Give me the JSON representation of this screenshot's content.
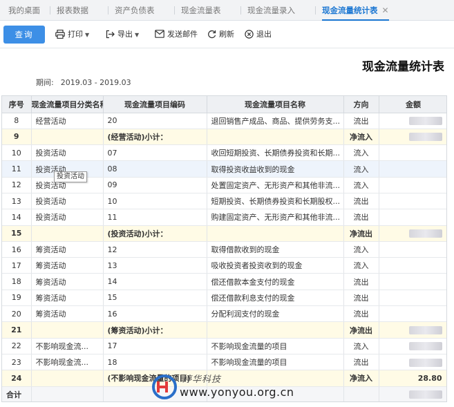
{
  "tabs": [
    {
      "label": "我的桌面"
    },
    {
      "label": "报表数据"
    },
    {
      "label": "资产负债表"
    },
    {
      "label": "现金流量表"
    },
    {
      "label": "现金流量录入"
    },
    {
      "label": "现金流量统计表",
      "active": true
    }
  ],
  "toolbar": {
    "query": "查询",
    "print": "打印",
    "export": "导出",
    "email": "发送邮件",
    "refresh": "刷新",
    "exit": "退出"
  },
  "report": {
    "title": "现金流量统计表",
    "period_label": "期间:",
    "period_value": "2019.03 - 2019.03"
  },
  "table": {
    "headers": [
      "序号",
      "现金流量项目分类名称",
      "现金流量项目编码",
      "现金流量项目名称",
      "方向",
      "金额"
    ],
    "rows": [
      {
        "no": "8",
        "cat": "经营活动",
        "code": "20",
        "name": "退回销售产成品、商品、提供劳务支...",
        "dir": "流出",
        "amt": ""
      },
      {
        "no": "9",
        "cat": "",
        "code": "(经营活动)小计：",
        "name": "",
        "dir": "净流入",
        "amt": ""
      },
      {
        "no": "10",
        "cat": "投资活动",
        "code": "07",
        "name": "收回短期投资、长期债券投资和长期...",
        "dir": "流入",
        "amt": ""
      },
      {
        "no": "11",
        "cat": "投资活动",
        "code": "08",
        "name": "取得投资收益收到的现金",
        "dir": "流入",
        "amt": ""
      },
      {
        "no": "12",
        "cat": "投资活动",
        "code": "09",
        "name": "处置固定资产、无形资产和其他非流...",
        "dir": "流入",
        "amt": ""
      },
      {
        "no": "13",
        "cat": "投资活动",
        "code": "10",
        "name": "短期投资、长期债券投资和长期股权...",
        "dir": "流出",
        "amt": ""
      },
      {
        "no": "14",
        "cat": "投资活动",
        "code": "11",
        "name": "购建固定资产、无形资产和其他非流...",
        "dir": "流出",
        "amt": ""
      },
      {
        "no": "15",
        "cat": "",
        "code": "(投资活动)小计：",
        "name": "",
        "dir": "净流出",
        "amt": ""
      },
      {
        "no": "16",
        "cat": "筹资活动",
        "code": "12",
        "name": "取得借款收到的现金",
        "dir": "流入",
        "amt": ""
      },
      {
        "no": "17",
        "cat": "筹资活动",
        "code": "13",
        "name": "吸收投资者投资收到的现金",
        "dir": "流入",
        "amt": ""
      },
      {
        "no": "18",
        "cat": "筹资活动",
        "code": "14",
        "name": "偿还借款本金支付的现金",
        "dir": "流出",
        "amt": ""
      },
      {
        "no": "19",
        "cat": "筹资活动",
        "code": "15",
        "name": "偿还借款利息支付的现金",
        "dir": "流出",
        "amt": ""
      },
      {
        "no": "20",
        "cat": "筹资活动",
        "code": "16",
        "name": "分配利润支付的现金",
        "dir": "流出",
        "amt": ""
      },
      {
        "no": "21",
        "cat": "",
        "code": "(筹资活动)小计：",
        "name": "",
        "dir": "净流出",
        "amt": ""
      },
      {
        "no": "22",
        "cat": "不影响现金流...",
        "code": "17",
        "name": "不影响现金流量的项目",
        "dir": "流入",
        "amt": ""
      },
      {
        "no": "23",
        "cat": "不影响现金流...",
        "code": "18",
        "name": "不影响现金流量的项目",
        "dir": "流出",
        "amt": ""
      },
      {
        "no": "24",
        "cat": "",
        "code": "(不影响现金流量的项目)",
        "name": "",
        "dir": "净流入",
        "amt": "28.80"
      },
      {
        "no": "合计",
        "cat": "",
        "code": "",
        "name": "",
        "dir": "",
        "amt": ""
      }
    ]
  },
  "tooltip": "投资活动",
  "watermark": {
    "brand": "婷华科技",
    "url": "www.yonyou.org.cn"
  },
  "colors": {
    "accent": "#1a76d2",
    "button": "#3d8fe6",
    "subtotal_bg": "#fffbe6"
  }
}
